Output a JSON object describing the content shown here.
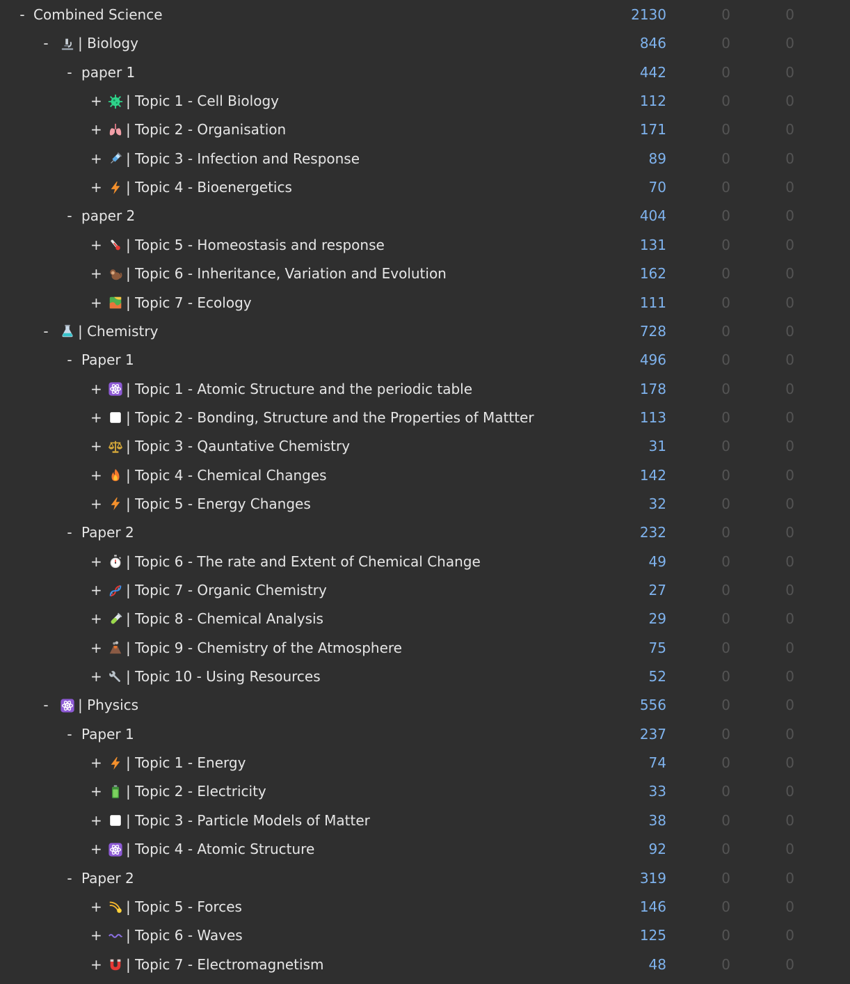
{
  "deck_tree": [
    {
      "depth": 0,
      "toggle": "-",
      "icon": "",
      "name": "Combined Science",
      "counts": [
        "2130",
        "0",
        "0"
      ]
    },
    {
      "depth": 1,
      "toggle": "-",
      "icon": "microscope-icon",
      "name": "| Biology",
      "counts": [
        "846",
        "0",
        "0"
      ]
    },
    {
      "depth": 2,
      "toggle": "-",
      "icon": "",
      "name": "paper 1",
      "counts": [
        "442",
        "0",
        "0"
      ]
    },
    {
      "depth": 3,
      "toggle": "+",
      "icon": "microbe-icon",
      "name": "| Topic 1 - Cell Biology",
      "counts": [
        "112",
        "0",
        "0"
      ]
    },
    {
      "depth": 3,
      "toggle": "+",
      "icon": "lungs-icon",
      "name": "| Topic 2 - Organisation",
      "counts": [
        "171",
        "0",
        "0"
      ]
    },
    {
      "depth": 3,
      "toggle": "+",
      "icon": "syringe-icon",
      "name": "| Topic 3 - Infection and Response",
      "counts": [
        "89",
        "0",
        "0"
      ]
    },
    {
      "depth": 3,
      "toggle": "+",
      "icon": "lightning-icon",
      "name": "| Topic 4 - Bioenergetics",
      "counts": [
        "70",
        "0",
        "0"
      ]
    },
    {
      "depth": 2,
      "toggle": "-",
      "icon": "",
      "name": "paper 2",
      "counts": [
        "404",
        "0",
        "0"
      ]
    },
    {
      "depth": 3,
      "toggle": "+",
      "icon": "thermometer-icon",
      "name": "| Topic 5 - Homeostasis and response",
      "counts": [
        "131",
        "0",
        "0"
      ]
    },
    {
      "depth": 3,
      "toggle": "+",
      "icon": "monkey-icon",
      "name": "| Topic 6 - Inheritance, Variation and Evolution",
      "counts": [
        "162",
        "0",
        "0"
      ]
    },
    {
      "depth": 3,
      "toggle": "+",
      "icon": "map-icon",
      "name": "| Topic 7 - Ecology",
      "counts": [
        "111",
        "0",
        "0"
      ]
    },
    {
      "depth": 1,
      "toggle": "-",
      "icon": "flask-icon",
      "name": "| Chemistry",
      "counts": [
        "728",
        "0",
        "0"
      ]
    },
    {
      "depth": 2,
      "toggle": "-",
      "icon": "",
      "name": "Paper 1",
      "counts": [
        "496",
        "0",
        "0"
      ]
    },
    {
      "depth": 3,
      "toggle": "+",
      "icon": "atom-icon",
      "name": "| Topic 1 - Atomic Structure and the periodic table",
      "counts": [
        "178",
        "0",
        "0"
      ]
    },
    {
      "depth": 3,
      "toggle": "+",
      "icon": "white-square-icon",
      "name": "| Topic 2 - Bonding, Structure and the Properties of Mattter",
      "counts": [
        "113",
        "0",
        "0"
      ]
    },
    {
      "depth": 3,
      "toggle": "+",
      "icon": "scales-icon",
      "name": "| Topic 3 - Qauntative Chemistry",
      "counts": [
        "31",
        "0",
        "0"
      ]
    },
    {
      "depth": 3,
      "toggle": "+",
      "icon": "fire-icon",
      "name": "| Topic 4 - Chemical Changes",
      "counts": [
        "142",
        "0",
        "0"
      ]
    },
    {
      "depth": 3,
      "toggle": "+",
      "icon": "lightning-icon",
      "name": "| Topic 5 - Energy Changes",
      "counts": [
        "32",
        "0",
        "0"
      ]
    },
    {
      "depth": 2,
      "toggle": "-",
      "icon": "",
      "name": "Paper 2",
      "counts": [
        "232",
        "0",
        "0"
      ]
    },
    {
      "depth": 3,
      "toggle": "+",
      "icon": "stopwatch-icon",
      "name": "| Topic 6 - The rate and Extent of Chemical Change",
      "counts": [
        "49",
        "0",
        "0"
      ]
    },
    {
      "depth": 3,
      "toggle": "+",
      "icon": "dna-icon",
      "name": "| Topic 7 - Organic Chemistry",
      "counts": [
        "27",
        "0",
        "0"
      ]
    },
    {
      "depth": 3,
      "toggle": "+",
      "icon": "test-tube-icon",
      "name": "| Topic 8 - Chemical Analysis",
      "counts": [
        "29",
        "0",
        "0"
      ]
    },
    {
      "depth": 3,
      "toggle": "+",
      "icon": "volcano-icon",
      "name": "| Topic 9 - Chemistry of the Atmosphere",
      "counts": [
        "75",
        "0",
        "0"
      ]
    },
    {
      "depth": 3,
      "toggle": "+",
      "icon": "wrench-icon",
      "name": "| Topic 10 - Using Resources",
      "counts": [
        "52",
        "0",
        "0"
      ]
    },
    {
      "depth": 1,
      "toggle": "-",
      "icon": "atom-icon",
      "name": "| Physics",
      "counts": [
        "556",
        "0",
        "0"
      ]
    },
    {
      "depth": 2,
      "toggle": "-",
      "icon": "",
      "name": "Paper 1",
      "counts": [
        "237",
        "0",
        "0"
      ]
    },
    {
      "depth": 3,
      "toggle": "+",
      "icon": "lightning-icon",
      "name": "| Topic 1 - Energy",
      "counts": [
        "74",
        "0",
        "0"
      ]
    },
    {
      "depth": 3,
      "toggle": "+",
      "icon": "battery-icon",
      "name": "| Topic 2 - Electricity",
      "counts": [
        "33",
        "0",
        "0"
      ]
    },
    {
      "depth": 3,
      "toggle": "+",
      "icon": "white-square-icon",
      "name": "| Topic 3 - Particle Models of Matter",
      "counts": [
        "38",
        "0",
        "0"
      ]
    },
    {
      "depth": 3,
      "toggle": "+",
      "icon": "atom-icon",
      "name": "| Topic 4 - Atomic Structure",
      "counts": [
        "92",
        "0",
        "0"
      ]
    },
    {
      "depth": 2,
      "toggle": "-",
      "icon": "",
      "name": "Paper 2",
      "counts": [
        "319",
        "0",
        "0"
      ]
    },
    {
      "depth": 3,
      "toggle": "+",
      "icon": "comet-icon",
      "name": "| Topic 5 - Forces",
      "counts": [
        "146",
        "0",
        "0"
      ]
    },
    {
      "depth": 3,
      "toggle": "+",
      "icon": "wavy-dash-icon",
      "name": "| Topic 6 - Waves",
      "counts": [
        "125",
        "0",
        "0"
      ]
    },
    {
      "depth": 3,
      "toggle": "+",
      "icon": "magnet-icon",
      "name": "| Topic 7 - Electromagnetism",
      "counts": [
        "48",
        "0",
        "0"
      ]
    }
  ],
  "colors": {
    "background": "#2f2f2f",
    "text": "#e6e6e6",
    "new_count": "#7fb3ee",
    "zero_count": "#545454"
  }
}
